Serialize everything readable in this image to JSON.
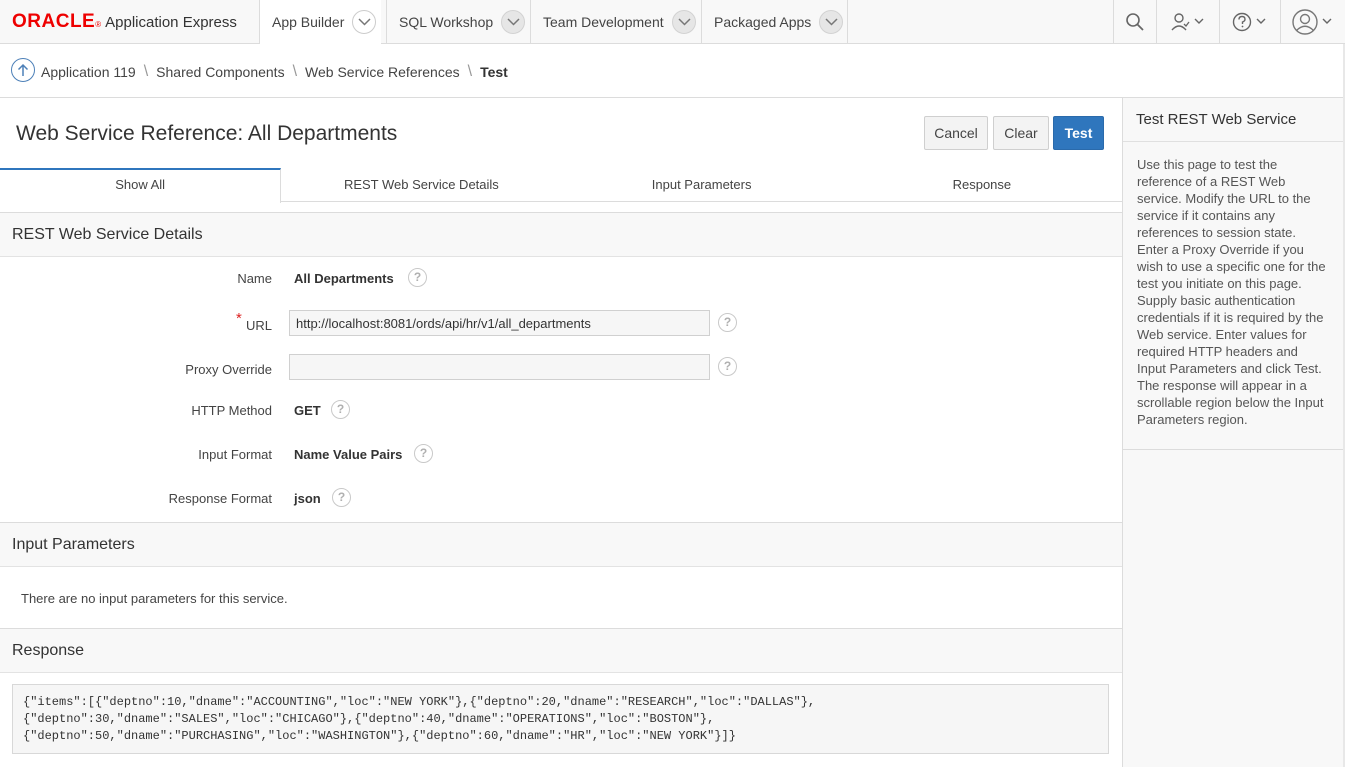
{
  "logo": {
    "brand": "ORACLE",
    "product": "Application Express"
  },
  "nav": {
    "tabs": [
      {
        "label": "App Builder"
      },
      {
        "label": "SQL Workshop"
      },
      {
        "label": "Team Development"
      },
      {
        "label": "Packaged Apps"
      }
    ]
  },
  "breadcrumb": {
    "items": [
      "Application 119",
      "Shared Components",
      "Web Service References"
    ],
    "current": "Test"
  },
  "page": {
    "title": "Web Service Reference: All Departments",
    "buttons": {
      "cancel": "Cancel",
      "clear": "Clear",
      "test": "Test"
    },
    "tabs": [
      "Show All",
      "REST Web Service Details",
      "Input Parameters",
      "Response"
    ]
  },
  "details": {
    "heading": "REST Web Service Details",
    "name_label": "Name",
    "name_value": "All Departments",
    "url_label": "URL",
    "url_value": "http://localhost:8081/ords/api/hr/v1/all_departments",
    "proxy_label": "Proxy Override",
    "proxy_value": "",
    "method_label": "HTTP Method",
    "method_value": "GET",
    "input_format_label": "Input Format",
    "input_format_value": "Name Value Pairs",
    "response_format_label": "Response Format",
    "response_format_value": "json"
  },
  "input_params": {
    "heading": "Input Parameters",
    "message": "There are no input parameters for this service."
  },
  "response": {
    "heading": "Response",
    "body": "{\"items\":[{\"deptno\":10,\"dname\":\"ACCOUNTING\",\"loc\":\"NEW YORK\"},{\"deptno\":20,\"dname\":\"RESEARCH\",\"loc\":\"DALLAS\"},\n{\"deptno\":30,\"dname\":\"SALES\",\"loc\":\"CHICAGO\"},{\"deptno\":40,\"dname\":\"OPERATIONS\",\"loc\":\"BOSTON\"},\n{\"deptno\":50,\"dname\":\"PURCHASING\",\"loc\":\"WASHINGTON\"},{\"deptno\":60,\"dname\":\"HR\",\"loc\":\"NEW YORK\"}]}"
  },
  "side_help": {
    "title": "Test REST Web Service",
    "text": "Use this page to test the reference of a REST Web service. Modify the URL to the service if it contains any references to session state. Enter a Proxy Override if you wish to use a specific one for the test you initiate on this page. Supply basic authentication credentials if it is required by the Web service. Enter values for required HTTP headers and Input Parameters and click Test. The response will appear in a scrollable region below the Input Parameters region."
  },
  "icons": {
    "search": "search-icon",
    "team": "team-icon",
    "help": "help-icon",
    "user": "user-icon",
    "up": "up-arrow-icon"
  },
  "colors": {
    "brand_red": "#ee0000",
    "primary_button": "#2f76bd"
  }
}
